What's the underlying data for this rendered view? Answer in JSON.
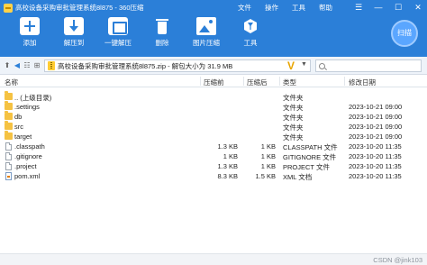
{
  "window": {
    "title": "高校设备采购审批管理系统8l875 - 360压缩",
    "menu": [
      "文件",
      "操作",
      "工具",
      "帮助"
    ],
    "controls": [
      "☰",
      "—",
      "☐",
      "✕"
    ]
  },
  "toolbar": {
    "tools": [
      {
        "label": "添加",
        "icon": "add-icon"
      },
      {
        "label": "解压到",
        "icon": "extract-icon"
      },
      {
        "label": "一键解压",
        "icon": "one-click-extract-icon"
      },
      {
        "label": "删除",
        "icon": "delete-icon"
      },
      {
        "label": "图片压缩",
        "icon": "image-compress-icon"
      },
      {
        "label": "工具",
        "icon": "tools-icon"
      }
    ],
    "scan_label": "扫描"
  },
  "address": {
    "path": "高校设备采购审批管理系统8l875.zip - 解包大小为 31.9 MB",
    "search_placeholder": ""
  },
  "columns": {
    "name": "名称",
    "size": "压缩前",
    "packed": "压缩后",
    "type": "类型",
    "modified": "修改日期"
  },
  "files": [
    {
      "name": ".. (上级目录)",
      "size": "",
      "packed": "",
      "type": "文件夹",
      "modified": "",
      "kind": "folder"
    },
    {
      "name": ".settings",
      "size": "",
      "packed": "",
      "type": "文件夹",
      "modified": "2023-10-21 09:00",
      "kind": "folder"
    },
    {
      "name": "db",
      "size": "",
      "packed": "",
      "type": "文件夹",
      "modified": "2023-10-21 09:00",
      "kind": "folder"
    },
    {
      "name": "src",
      "size": "",
      "packed": "",
      "type": "文件夹",
      "modified": "2023-10-21 09:00",
      "kind": "folder"
    },
    {
      "name": "target",
      "size": "",
      "packed": "",
      "type": "文件夹",
      "modified": "2023-10-21 09:00",
      "kind": "folder"
    },
    {
      "name": ".classpath",
      "size": "1.3 KB",
      "packed": "1 KB",
      "type": "CLASSPATH 文件",
      "modified": "2023-10-20 11:35",
      "kind": "file"
    },
    {
      "name": ".gitignore",
      "size": "1 KB",
      "packed": "1 KB",
      "type": "GITIGNORE 文件",
      "modified": "2023-10-20 11:35",
      "kind": "file"
    },
    {
      "name": ".project",
      "size": "1.3 KB",
      "packed": "1 KB",
      "type": "PROJECT 文件",
      "modified": "2023-10-20 11:35",
      "kind": "file"
    },
    {
      "name": "pom.xml",
      "size": "8.3 KB",
      "packed": "1.5 KB",
      "type": "XML 文档",
      "modified": "2023-10-20 11:35",
      "kind": "xml"
    }
  ],
  "watermark": "CSDN @jink103"
}
